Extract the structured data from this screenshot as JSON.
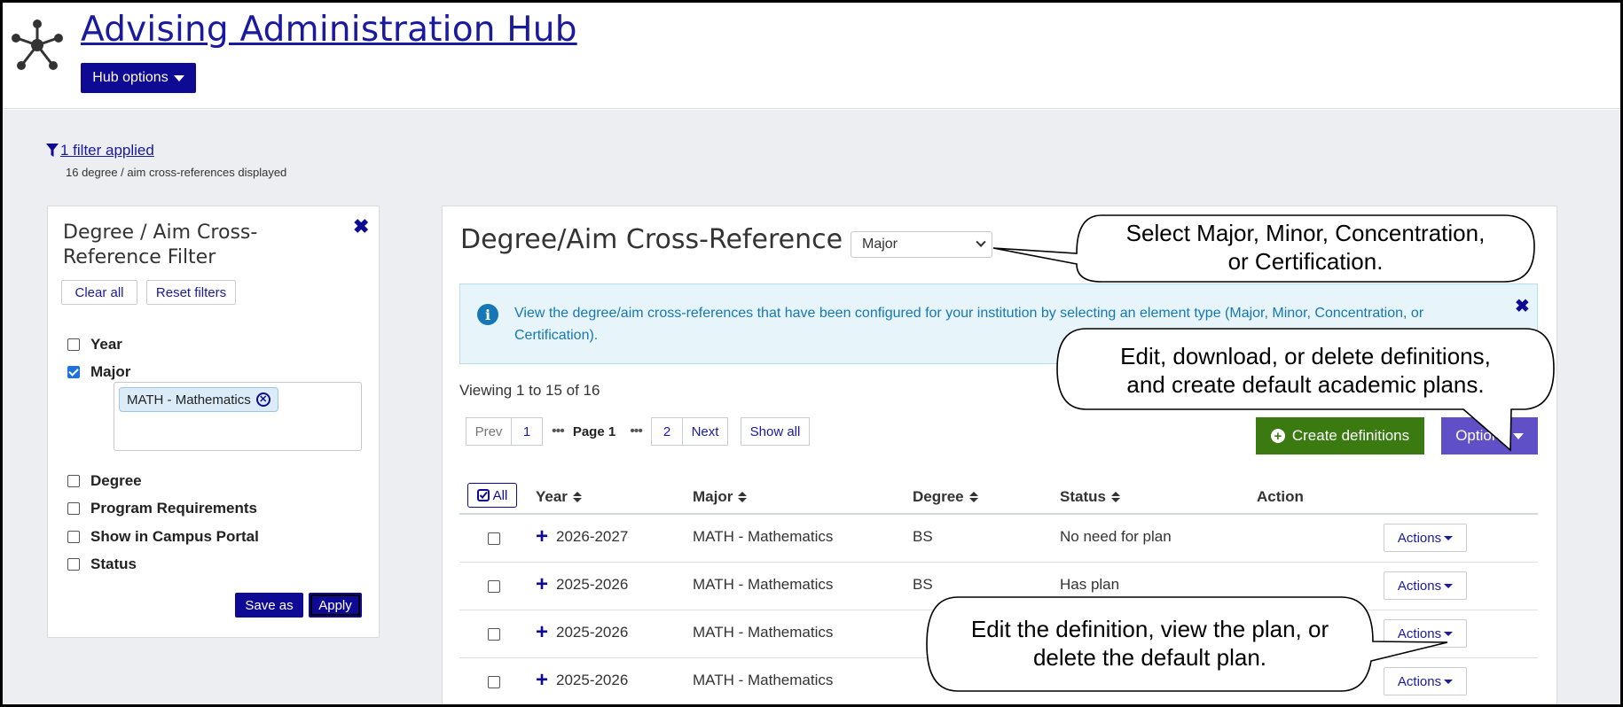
{
  "header": {
    "title": "Advising Administration Hub",
    "hub_options_label": "Hub options"
  },
  "filter_summary": {
    "link_text": "1 filter applied",
    "subtext": "16 degree / aim cross-references displayed"
  },
  "filter_panel": {
    "title": "Degree / Aim Cross-Reference Filter",
    "clear_all_label": "Clear all",
    "reset_filters_label": "Reset filters",
    "items": [
      {
        "label": "Year",
        "checked": false
      },
      {
        "label": "Major",
        "checked": true
      },
      {
        "label": "Degree",
        "checked": false
      },
      {
        "label": "Program Requirements",
        "checked": false
      },
      {
        "label": "Show in Campus Portal",
        "checked": false
      },
      {
        "label": "Status",
        "checked": false
      }
    ],
    "major_tag": "MATH - Mathematics",
    "save_as_label": "Save as",
    "apply_label": "Apply"
  },
  "main": {
    "title": "Degree/Aim Cross-Reference",
    "type_select_value": "Major",
    "info_text": "View the degree/aim cross-references that have been configured for your institution by selecting an element type (Major, Minor, Concentration, or Certification).",
    "viewing_text": "Viewing 1 to 15 of 16",
    "pager": {
      "prev": "Prev",
      "first": "1",
      "current": "Page 1",
      "second": "2",
      "next": "Next",
      "show_all": "Show all"
    },
    "create_label": "Create definitions",
    "options_label": "Options",
    "table": {
      "all_label": "All",
      "headers": [
        "Year",
        "Major",
        "Degree",
        "Status",
        "Action"
      ],
      "rows": [
        {
          "year": "2026-2027",
          "major": "MATH - Mathematics",
          "degree": "BS",
          "status": "No need for plan",
          "action": "Actions"
        },
        {
          "year": "2025-2026",
          "major": "MATH - Mathematics",
          "degree": "BS",
          "status": "Has plan",
          "action": "Actions"
        },
        {
          "year": "2025-2026",
          "major": "MATH - Mathematics",
          "degree": "",
          "status": "",
          "action": "Actions"
        },
        {
          "year": "2025-2026",
          "major": "MATH - Mathematics",
          "degree": "",
          "status": "",
          "action": "Actions"
        }
      ]
    }
  },
  "callouts": {
    "type_select": [
      "Select Major, Minor, Concentration,",
      "or Certification."
    ],
    "options": [
      "Edit, download, or delete definitions,",
      "and create default academic plans."
    ],
    "actions": [
      "Edit the definition, view the plan, or",
      "delete the default plan."
    ]
  },
  "colors": {
    "brand_navy": "#0e0a94",
    "create_green": "#3a7a10",
    "options_purple": "#6050c8",
    "info_blue": "#1577b6"
  }
}
